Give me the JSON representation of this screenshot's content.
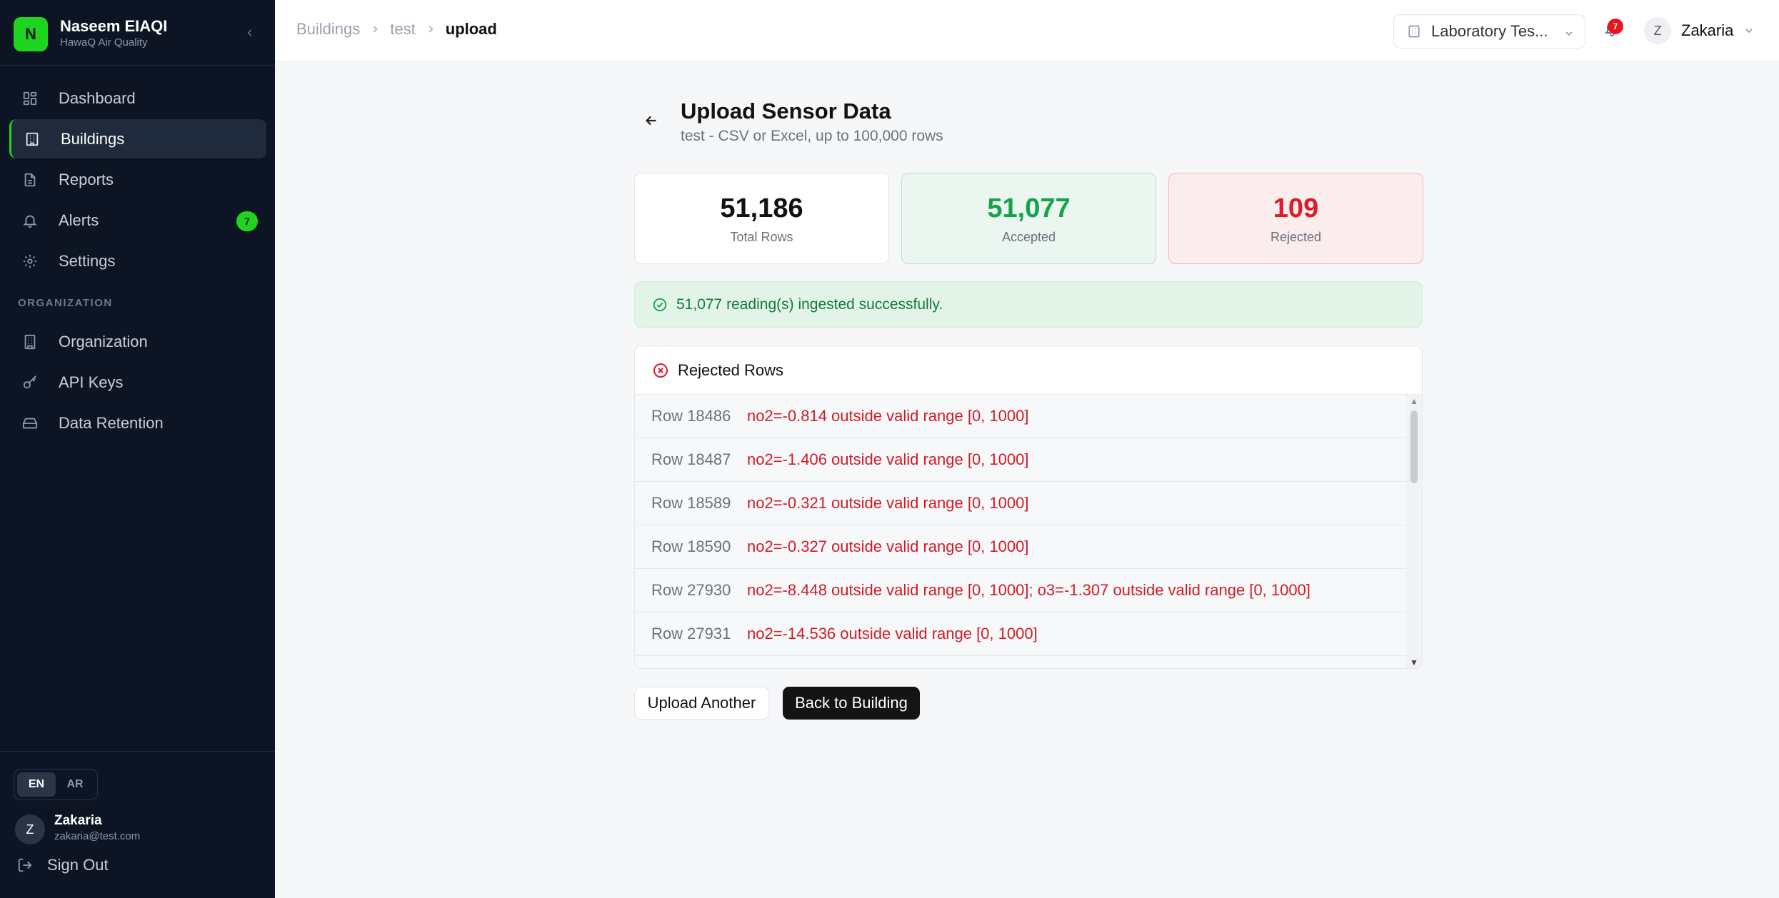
{
  "sidebar": {
    "brand": {
      "logo_letter": "N",
      "name": "Naseem EIAQI",
      "subtitle": "HawaQ Air Quality"
    },
    "nav": [
      {
        "label": "Dashboard",
        "icon": "grid-icon",
        "active": false
      },
      {
        "label": "Buildings",
        "icon": "building-icon",
        "active": true
      },
      {
        "label": "Reports",
        "icon": "file-icon",
        "active": false
      },
      {
        "label": "Alerts",
        "icon": "bell-icon",
        "active": false,
        "badge": "7"
      },
      {
        "label": "Settings",
        "icon": "gear-icon",
        "active": false
      }
    ],
    "section_label": "ORGANIZATION",
    "org_nav": [
      {
        "label": "Organization",
        "icon": "office-icon"
      },
      {
        "label": "API Keys",
        "icon": "key-icon"
      },
      {
        "label": "Data Retention",
        "icon": "hard-drive-icon"
      }
    ],
    "languages": [
      "EN",
      "AR"
    ],
    "active_language": "EN",
    "user": {
      "initial": "Z",
      "name": "Zakaria",
      "email": "zakaria@test.com"
    },
    "sign_out": "Sign Out"
  },
  "header": {
    "breadcrumb": [
      "Buildings",
      "test",
      "upload"
    ],
    "building_select": "Laboratory Tes...",
    "notification_count": "7",
    "user": {
      "initial": "Z",
      "name": "Zakaria"
    }
  },
  "main": {
    "title": "Upload Sensor Data",
    "subtitle": "test - CSV or Excel, up to 100,000 rows",
    "stats": {
      "total": {
        "value": "51,186",
        "label": "Total Rows"
      },
      "accepted": {
        "value": "51,077",
        "label": "Accepted"
      },
      "rejected": {
        "value": "109",
        "label": "Rejected"
      }
    },
    "success_message": "51,077 reading(s) ingested successfully.",
    "rejected_title": "Rejected Rows",
    "rejected_rows": [
      {
        "row": "Row 18486",
        "message": "no2=-0.814 outside valid range [0, 1000]"
      },
      {
        "row": "Row 18487",
        "message": "no2=-1.406 outside valid range [0, 1000]"
      },
      {
        "row": "Row 18589",
        "message": "no2=-0.321 outside valid range [0, 1000]"
      },
      {
        "row": "Row 18590",
        "message": "no2=-0.327 outside valid range [0, 1000]"
      },
      {
        "row": "Row 27930",
        "message": "no2=-8.448 outside valid range [0, 1000]; o3=-1.307 outside valid range [0, 1000]"
      },
      {
        "row": "Row 27931",
        "message": "no2=-14.536 outside valid range [0, 1000]"
      }
    ],
    "buttons": {
      "upload_another": "Upload Another",
      "back_to_building": "Back to Building"
    }
  },
  "colors": {
    "brand_green": "#1fd41f",
    "sidebar_bg": "#0d1525",
    "accepted_green": "#15a34a",
    "rejected_red": "#dc1c26"
  }
}
